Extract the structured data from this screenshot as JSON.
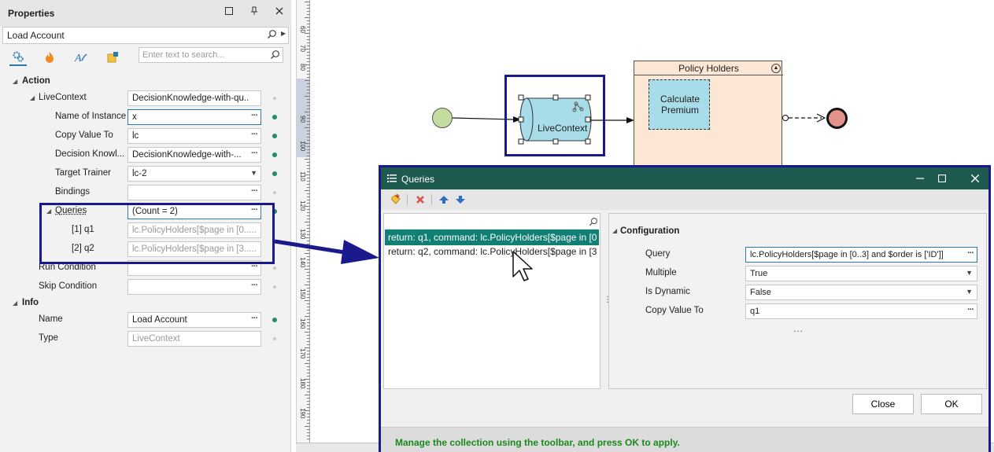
{
  "properties_panel": {
    "title": "Properties",
    "object_name": "Load Account",
    "search_placeholder": "Enter text to search...",
    "categories": {
      "action": "Action",
      "info": "Info"
    },
    "rows": {
      "livecontext": {
        "label": "LiveContext",
        "value": "DecisionKnowledge-with-qu..."
      },
      "name_of_instance": {
        "label": "Name of Instance",
        "value": "x"
      },
      "copy_value_to": {
        "label": "Copy Value To",
        "value": "lc"
      },
      "decision_knowledge": {
        "label": "Decision Knowl...",
        "value": "DecisionKnowledge-with-..."
      },
      "target_trainer": {
        "label": "Target Trainer",
        "value": "lc-2"
      },
      "bindings": {
        "label": "Bindings",
        "value": ""
      },
      "queries": {
        "label": "Queries",
        "value": "(Count = 2)"
      },
      "q1": {
        "label": "[1] q1",
        "value": "lc.PolicyHolders[$page in [0....."
      },
      "q2": {
        "label": "[2] q2",
        "value": "lc.PolicyHolders[$page in [3....."
      },
      "run_condition": {
        "label": "Run Condition",
        "value": ""
      },
      "skip_condition": {
        "label": "Skip Condition",
        "value": ""
      },
      "name": {
        "label": "Name",
        "value": "Load Account"
      },
      "type": {
        "label": "Type",
        "value": "LiveContext"
      }
    }
  },
  "canvas": {
    "ruler_marks": [
      "60",
      "70",
      "80",
      "90",
      "100",
      "110",
      "120",
      "130",
      "140",
      "150",
      "160",
      "170",
      "180",
      "190"
    ],
    "livecontext_shape_label": "LiveContext",
    "pool_title": "Policy Holders",
    "task_label_line1": "Calculate",
    "task_label_line2": "Premium"
  },
  "dialog": {
    "title": "Queries",
    "list_items": [
      "return: q1, command: lc.PolicyHolders[$page in [0",
      "return: q2, command: lc.PolicyHolders[$page in [3"
    ],
    "configuration": {
      "heading": "Configuration",
      "query": {
        "label": "Query",
        "value": "lc.PolicyHolders[$page in [0..3] and $order is ['ID']]"
      },
      "multiple": {
        "label": "Multiple",
        "value": "True"
      },
      "is_dynamic": {
        "label": "Is Dynamic",
        "value": "False"
      },
      "copy_value_to": {
        "label": "Copy Value To",
        "value": "q1"
      },
      "more": "..."
    },
    "close_button": "Close",
    "ok_button": "OK",
    "status_text": "Manage the collection using the toolbar, and press OK to apply."
  },
  "colors": {
    "dialog_title_bar": "#1e5a4f",
    "selection": "#117f73",
    "highlight_box": "#1a1a8c",
    "status_text": "#1a8a1a",
    "pool_fill": "#fce6d4",
    "task_fill": "#a8dce8"
  }
}
